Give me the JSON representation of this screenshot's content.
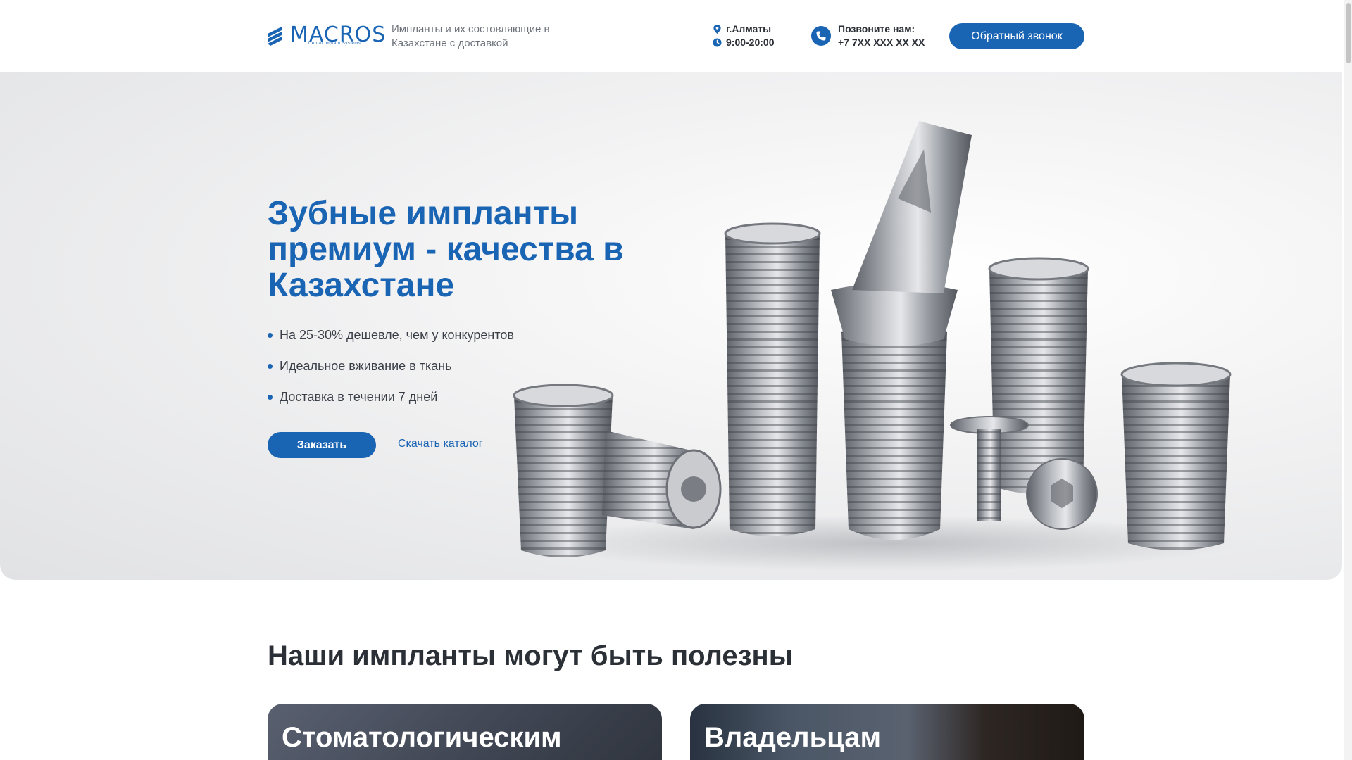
{
  "header": {
    "logo_text": "MACROS",
    "logo_subtitle": "Dental Implant Systems",
    "tagline": "Импланты и их состовляющие в Казахстане с доставкой",
    "city": "г.Алматы",
    "hours": "9:00-20:00",
    "call_label": "Позвоните нам:",
    "phone": "+7 7XX XXX XX XX",
    "callback_button": "Обратный звонок"
  },
  "hero": {
    "title": "Зубные импланты премиум - качества в Казахстане",
    "bullets": [
      "На 25-30% дешевле, чем у конкурентов",
      "Идеальное вживание в ткань",
      "Доставка в течении 7 дней"
    ],
    "order_button": "Заказать",
    "catalog_link": "Скачать каталог"
  },
  "section": {
    "title": "Наши импланты могут быть полезны",
    "cards": [
      {
        "title": "Стоматологическим"
      },
      {
        "title": "Владельцам"
      }
    ]
  },
  "colors": {
    "accent": "#1a64b4",
    "text": "#2b2f36",
    "muted": "#6d727a"
  }
}
